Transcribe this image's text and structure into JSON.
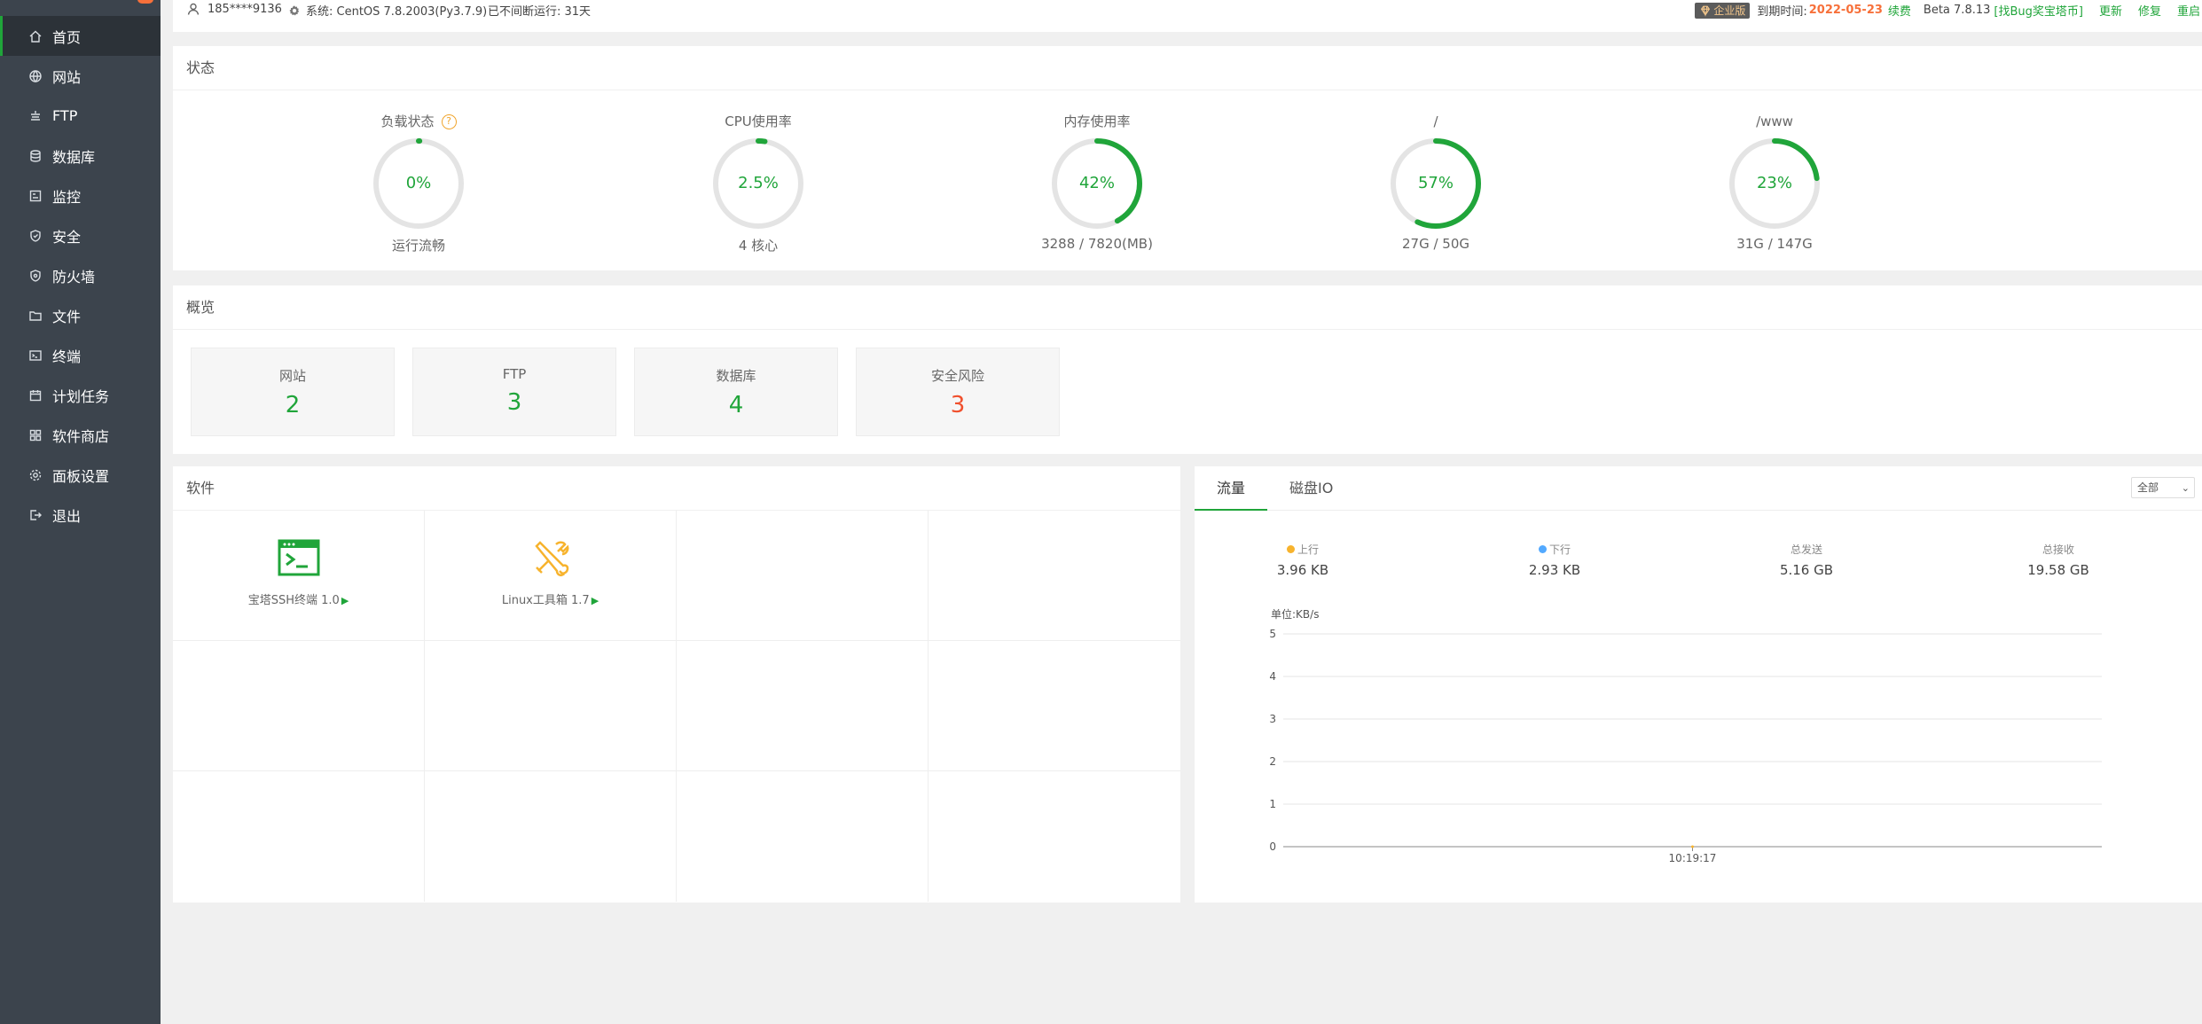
{
  "sidebar": {
    "items": [
      {
        "label": "首页",
        "icon": "home-icon",
        "active": true
      },
      {
        "label": "网站",
        "icon": "globe-icon"
      },
      {
        "label": "FTP",
        "icon": "ftp-icon"
      },
      {
        "label": "数据库",
        "icon": "database-icon"
      },
      {
        "label": "监控",
        "icon": "monitor-icon"
      },
      {
        "label": "安全",
        "icon": "shield-icon"
      },
      {
        "label": "防火墙",
        "icon": "firewall-icon"
      },
      {
        "label": "文件",
        "icon": "folder-icon"
      },
      {
        "label": "终端",
        "icon": "terminal-icon"
      },
      {
        "label": "计划任务",
        "icon": "calendar-icon"
      },
      {
        "label": "软件商店",
        "icon": "apps-icon"
      },
      {
        "label": "面板设置",
        "icon": "gear-icon"
      },
      {
        "label": "退出",
        "icon": "logout-icon"
      }
    ]
  },
  "topbar": {
    "user": "185****9136",
    "system": "系统:   CentOS 7.8.2003(Py3.7.9)",
    "uptime": "已不间断运行: 31天",
    "edition": "企业版",
    "expire_label": "到期时间:",
    "expire_date": "2022-05-23",
    "renew": "续费",
    "version": "Beta  7.8.13",
    "bug_reward": "[找Bug奖宝塔币]",
    "update": "更新",
    "repair": "修复",
    "restart": "重启"
  },
  "status": {
    "title": "状态",
    "gauges": [
      {
        "title": "负载状态",
        "value": "0%",
        "sub": "运行流畅",
        "percent": 0,
        "help": "?"
      },
      {
        "title": "CPU使用率",
        "value": "2.5%",
        "sub": "4 核心",
        "percent": 2.5
      },
      {
        "title": "内存使用率",
        "value": "42%",
        "sub": "3288 / 7820(MB)",
        "percent": 42
      },
      {
        "title": "/",
        "value": "57%",
        "sub": "27G / 50G",
        "percent": 57
      },
      {
        "title": "/www",
        "value": "23%",
        "sub": "31G / 147G",
        "percent": 23
      }
    ]
  },
  "overview": {
    "title": "概览",
    "cards": [
      {
        "label": "网站",
        "value": "2"
      },
      {
        "label": "FTP",
        "value": "3"
      },
      {
        "label": "数据库",
        "value": "4"
      },
      {
        "label": "安全风险",
        "value": "3"
      }
    ]
  },
  "software": {
    "title": "软件",
    "items": [
      {
        "name": "宝塔SSH终端 1.0",
        "icon": "ssh-terminal-icon",
        "play": "▶"
      },
      {
        "name": "Linux工具箱 1.7",
        "icon": "toolbox-icon",
        "play": "▶"
      }
    ]
  },
  "traffic": {
    "tabs": [
      "流量",
      "磁盘IO"
    ],
    "range": "全部",
    "stats": [
      {
        "label": "上行",
        "value": "3.96 KB",
        "dot": "#f7b32d"
      },
      {
        "label": "下行",
        "value": "2.93 KB",
        "dot": "#52a9ff"
      },
      {
        "label": "总发送",
        "value": "5.16 GB"
      },
      {
        "label": "总接收",
        "value": "19.58 GB"
      }
    ]
  },
  "chart_data": {
    "type": "line",
    "ylabel": "单位:KB/s",
    "ylim": [
      0,
      5
    ],
    "yticks": [
      "0",
      "1",
      "2",
      "3",
      "4",
      "5"
    ],
    "x": [
      "10:19:17"
    ],
    "series": [
      {
        "values": [
          0
        ]
      }
    ],
    "grid": true
  },
  "colors": {
    "accent": "#20a53a",
    "sidebar": "#3c444d",
    "risk": "#f0502d",
    "warn": "#f7703a"
  }
}
